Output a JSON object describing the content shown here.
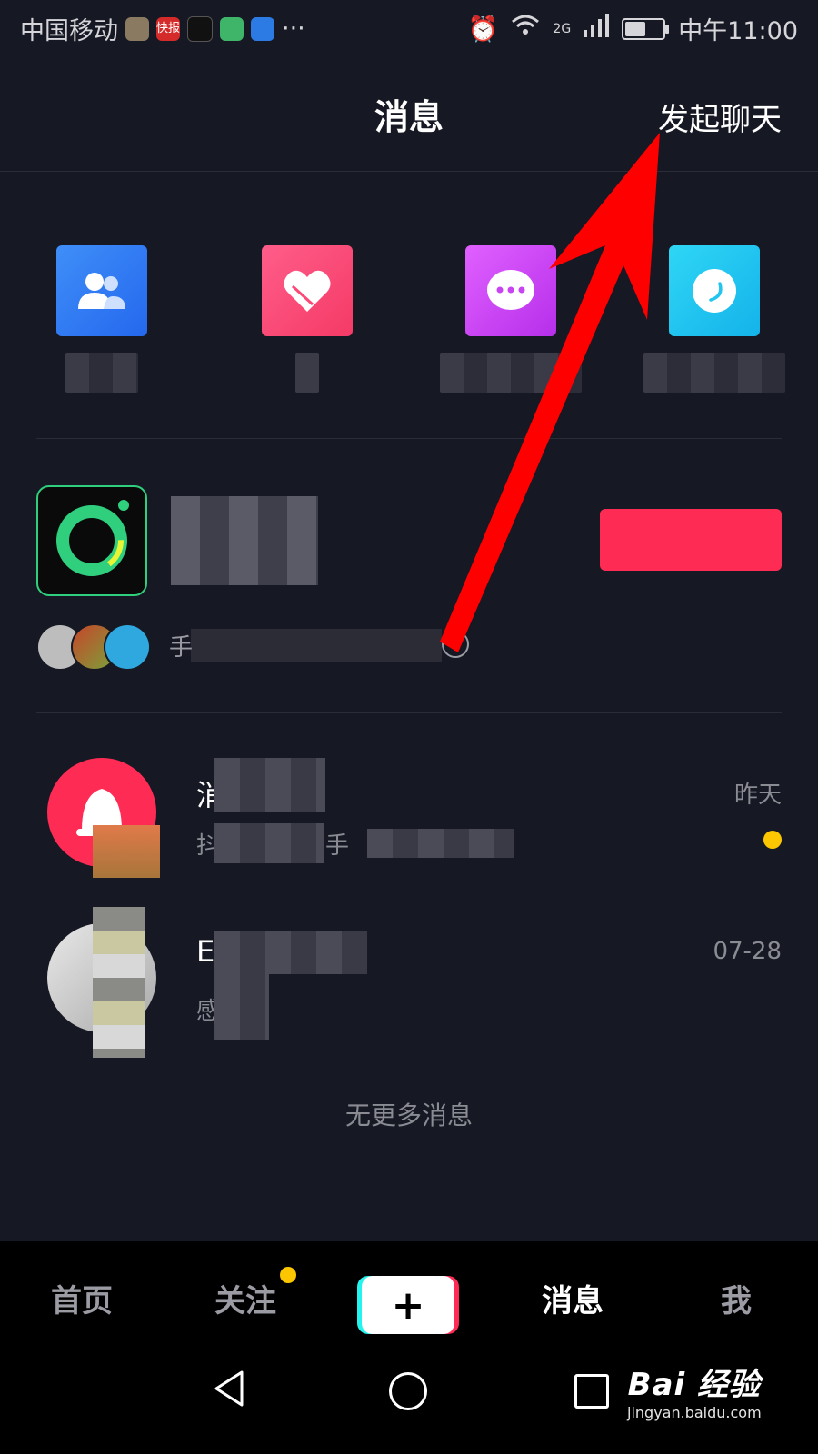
{
  "status_bar": {
    "carrier": "中国移动",
    "more_dots": "···",
    "network": "2G",
    "time": "中午11:00",
    "notification_app_label": "快报"
  },
  "header": {
    "title": "消息",
    "start_chat": "发起聊天"
  },
  "shortcuts": [
    {
      "icon": "fans-icon",
      "color": "#2f7df6",
      "label": ""
    },
    {
      "icon": "heart-icon",
      "color": "#fc4a78",
      "label": ""
    },
    {
      "icon": "chat-bubble-icon",
      "color": "#c844f2",
      "label": ""
    },
    {
      "icon": "at-icon",
      "color": "#21c5ee",
      "label": ""
    }
  ],
  "live_card": {
    "name": "",
    "subtitle": "手",
    "button_label": ""
  },
  "conversations": [
    {
      "name": "消",
      "preview": "抖",
      "preview_end": "手",
      "time": "昨天",
      "unread": true
    },
    {
      "name": "E",
      "preview": "感",
      "time": "07-28",
      "unread": false
    }
  ],
  "no_more": "无更多消息",
  "tabbar": {
    "items": [
      "首页",
      "关注",
      "消息",
      "我"
    ],
    "plus": "+",
    "active": "消息"
  },
  "watermark": {
    "brand": "Bai 经验",
    "url": "jingyan.baidu.com"
  },
  "colors": {
    "background": "#161823",
    "accent_red": "#fe2c55",
    "unread_yellow": "#fcc700",
    "annotation_arrow": "#ff0000"
  }
}
